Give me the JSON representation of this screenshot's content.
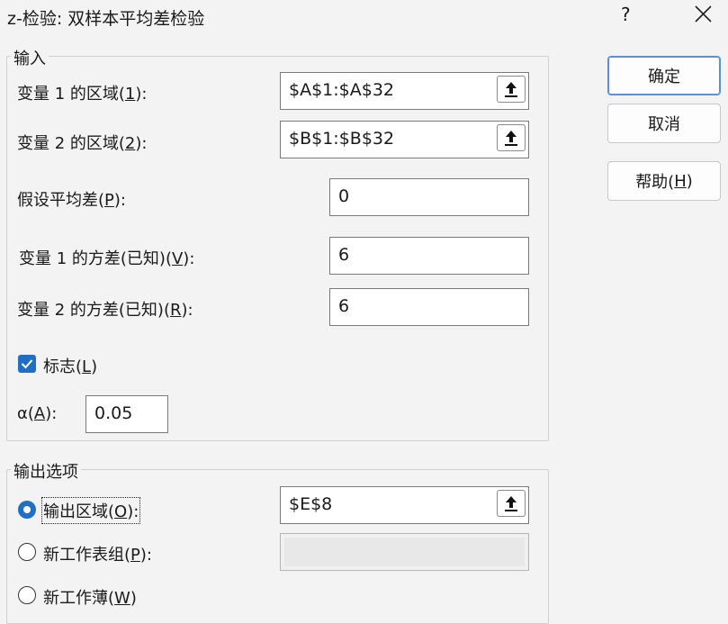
{
  "window": {
    "title": "z-检验: 双样本平均差检验",
    "help_glyph": "?"
  },
  "input_group": {
    "legend": "输入",
    "range1": {
      "label_pre": "变量 1 的区域(",
      "key": "1",
      "label_post": "):",
      "value": "$A$1:$A$32"
    },
    "range2": {
      "label_pre": "变量 2 的区域(",
      "key": "2",
      "label_post": "):",
      "value": "$B$1:$B$32"
    },
    "hyp_mean": {
      "label_pre": "假设平均差(",
      "key": "P",
      "label_post": "):",
      "value": "0"
    },
    "var1": {
      "label_pre": "变量 1 的方差(已知)(",
      "key": "V",
      "label_post": "):",
      "value": "6"
    },
    "var2": {
      "label_pre": "变量 2 的方差(已知)(",
      "key": "R",
      "label_post": "):",
      "value": "6"
    },
    "labels": {
      "label_pre": "标志(",
      "key": "L",
      "label_post": ")",
      "checked": true
    },
    "alpha": {
      "label_pre": "α(",
      "key": "A",
      "label_post": "):",
      "value": "0.05"
    }
  },
  "output_group": {
    "legend": "输出选项",
    "output_range": {
      "label_pre": "输出区域(",
      "key": "O",
      "label_post": "):",
      "value": "$E$8",
      "selected": true
    },
    "new_sheet": {
      "label_pre": "新工作表组(",
      "key": "P",
      "label_post": "):",
      "value": "",
      "selected": false
    },
    "new_book": {
      "label_pre": "新工作薄(",
      "key": "W",
      "label_post": ")",
      "selected": false
    }
  },
  "buttons": {
    "ok": "确定",
    "cancel": "取消",
    "help_pre": "帮助(",
    "help_key": "H",
    "help_post": ")"
  },
  "colors": {
    "accent": "#1f6fc5",
    "dialog_bg": "#f3f3f3"
  },
  "icons": {
    "ref_button": "collapse-dialog-arrow-icon",
    "close": "close-icon",
    "check": "checkmark-icon"
  }
}
